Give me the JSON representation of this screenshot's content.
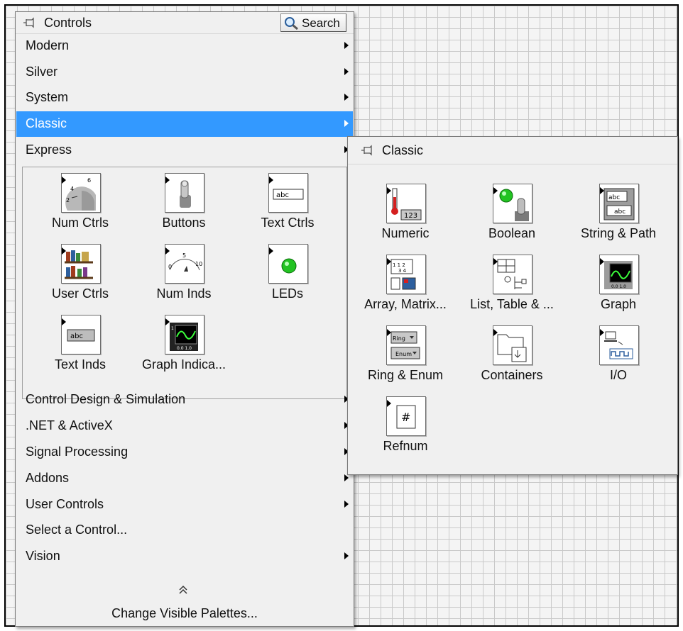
{
  "controls_palette": {
    "title": "Controls",
    "search_label": "Search",
    "top_items": [
      {
        "label": "Modern",
        "has_submenu": true
      },
      {
        "label": "Silver",
        "has_submenu": true
      },
      {
        "label": "System",
        "has_submenu": true
      },
      {
        "label": "Classic",
        "has_submenu": true,
        "selected": true
      },
      {
        "label": "Express",
        "has_submenu": true
      }
    ],
    "express_tiles": [
      {
        "label": "Num Ctrls",
        "icon": "num-ctrls-icon"
      },
      {
        "label": "Buttons",
        "icon": "buttons-icon"
      },
      {
        "label": "Text Ctrls",
        "icon": "text-ctrls-icon"
      },
      {
        "label": "User Ctrls",
        "icon": "user-ctrls-icon"
      },
      {
        "label": "Num Inds",
        "icon": "num-inds-icon"
      },
      {
        "label": "LEDs",
        "icon": "leds-icon"
      },
      {
        "label": "Text Inds",
        "icon": "text-inds-icon"
      },
      {
        "label": "Graph Indica...",
        "icon": "graph-indicators-icon"
      }
    ],
    "bottom_items": [
      {
        "label": "Control Design & Simulation",
        "has_submenu": true
      },
      {
        "label": ".NET & ActiveX",
        "has_submenu": true
      },
      {
        "label": "Signal Processing",
        "has_submenu": true
      },
      {
        "label": "Addons",
        "has_submenu": true
      },
      {
        "label": "User Controls",
        "has_submenu": true
      },
      {
        "label": "Select a Control...",
        "has_submenu": false
      },
      {
        "label": "Vision",
        "has_submenu": true
      }
    ],
    "change_visible_palettes": "Change Visible Palettes..."
  },
  "classic_palette": {
    "title": "Classic",
    "tiles": [
      {
        "label": "Numeric",
        "icon": "numeric-icon"
      },
      {
        "label": "Boolean",
        "icon": "boolean-icon"
      },
      {
        "label": "String & Path",
        "icon": "string-path-icon"
      },
      {
        "label": "Array, Matrix...",
        "icon": "array-matrix-icon"
      },
      {
        "label": "List, Table & ...",
        "icon": "list-table-icon"
      },
      {
        "label": "Graph",
        "icon": "graph-icon"
      },
      {
        "label": "Ring & Enum",
        "icon": "ring-enum-icon"
      },
      {
        "label": "Containers",
        "icon": "containers-icon"
      },
      {
        "label": "I/O",
        "icon": "io-icon"
      },
      {
        "label": "Refnum",
        "icon": "refnum-icon"
      }
    ]
  },
  "colors": {
    "selection": "#3399ff",
    "palette_bg": "#f0f0f0",
    "grid_line": "#c9c9c9"
  }
}
